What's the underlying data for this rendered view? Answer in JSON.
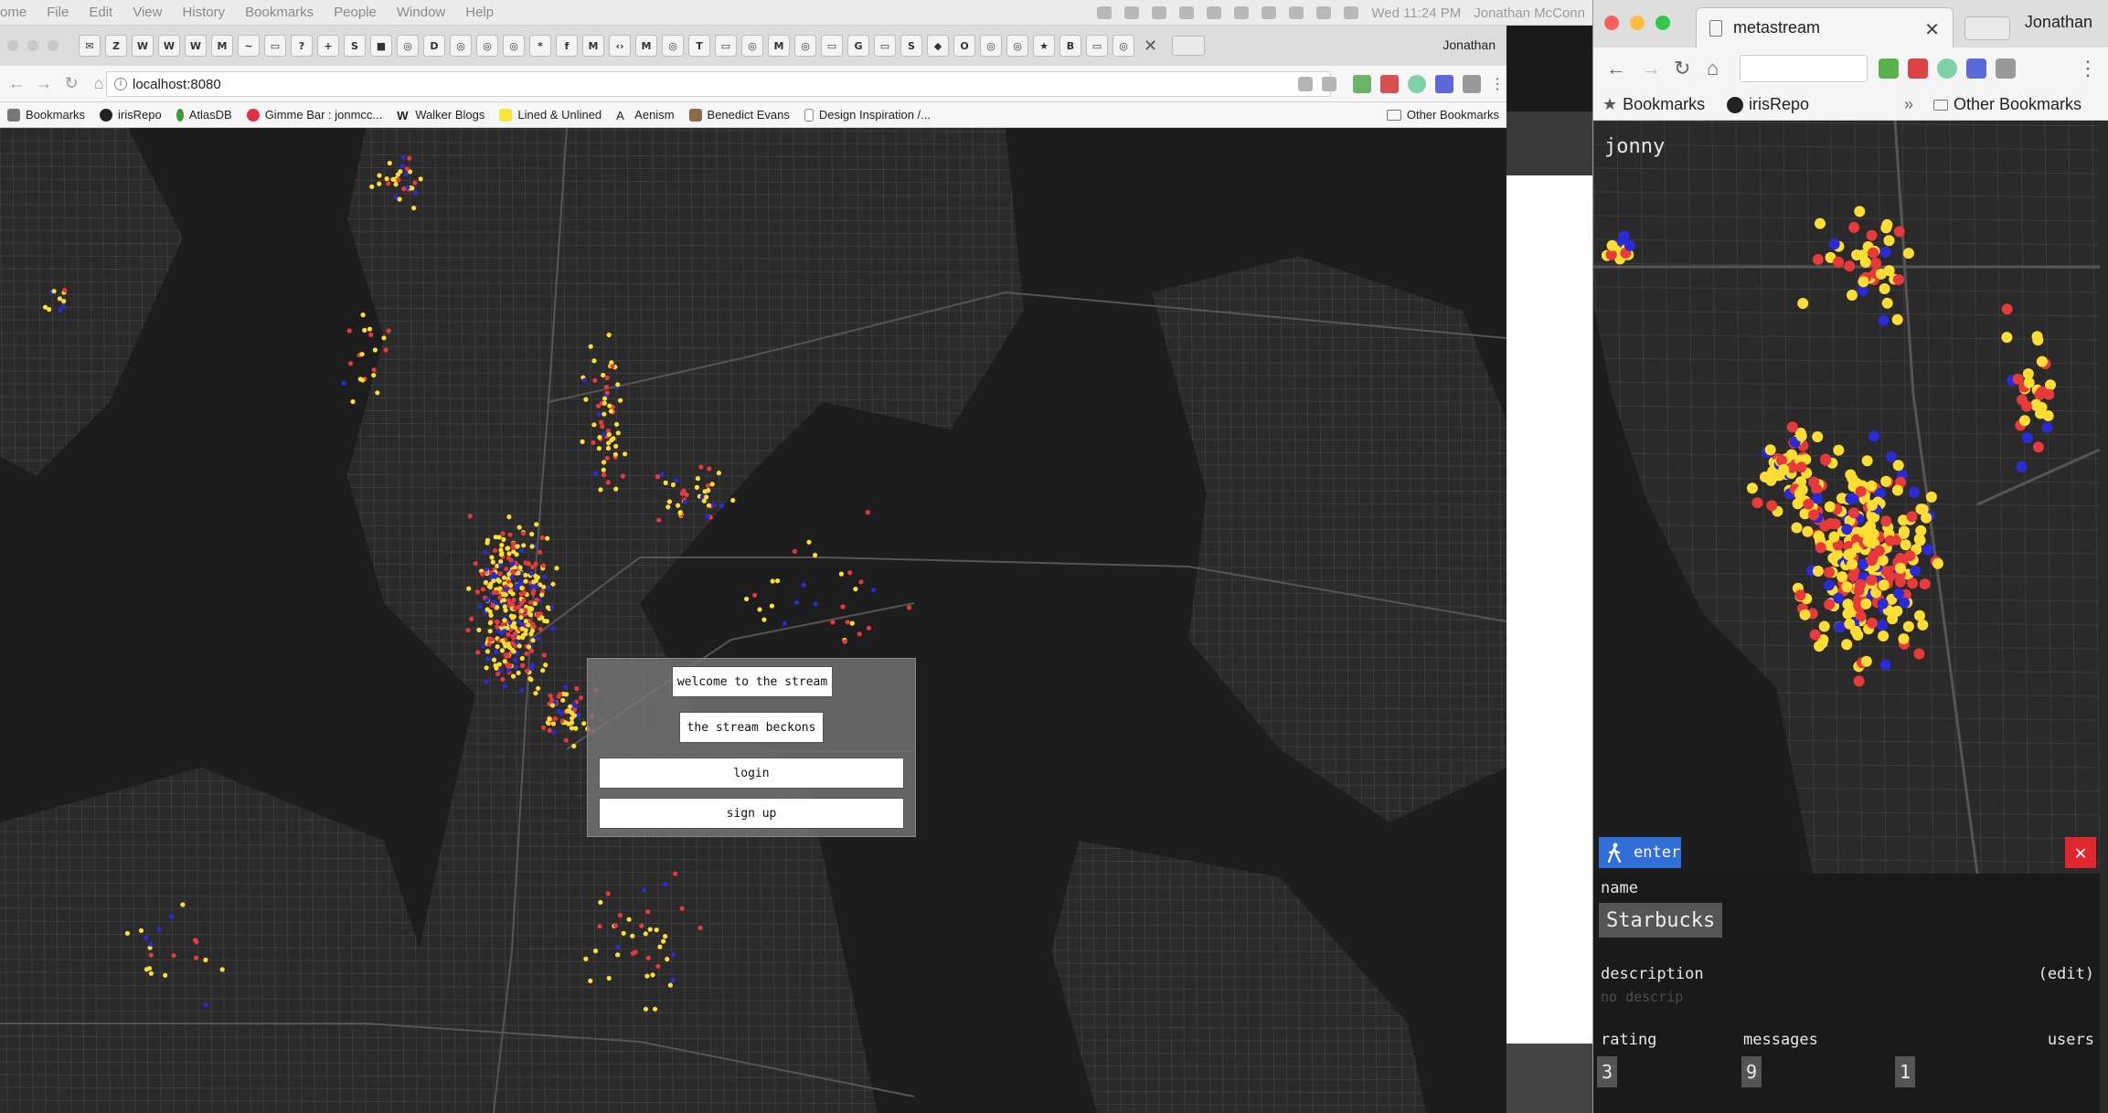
{
  "menubar": {
    "app": "ome",
    "items": [
      "File",
      "Edit",
      "View",
      "History",
      "Bookmarks",
      "People",
      "Window",
      "Help"
    ],
    "clock": "Wed 11:24 PM",
    "user": "Jonathan McConn"
  },
  "left_window": {
    "profile": "Jonathan",
    "url": "localhost:8080",
    "pinned_tabs": [
      "✉",
      "Z",
      "W",
      "W",
      "W",
      "M",
      "~",
      "▭",
      "?",
      "+",
      "S",
      "■",
      "◎",
      "D",
      "◎",
      "◎",
      "◎",
      "*",
      "f",
      "M",
      "‹›",
      "M",
      "◎",
      "T",
      "▭",
      "◎",
      "M",
      "◎",
      "▭",
      "G",
      "▭",
      "S",
      "◆",
      "O",
      "◎",
      "◎",
      "★",
      "B",
      "▭",
      "◎"
    ],
    "bookmarks": [
      {
        "label": "Bookmarks",
        "icon": "star-icon"
      },
      {
        "label": "irisRepo",
        "icon": "github-icon"
      },
      {
        "label": "AtlasDB",
        "icon": "leaf-icon"
      },
      {
        "label": "Gimme Bar : jonmcc...",
        "icon": "gimme-icon"
      },
      {
        "label": "Walker Blogs",
        "icon": "w-icon"
      },
      {
        "label": "Lined & Unlined",
        "icon": "square-icon"
      },
      {
        "label": "Aenism",
        "icon": "a-icon"
      },
      {
        "label": "Benedict Evans",
        "icon": "image-icon"
      },
      {
        "label": "Design Inspiration /...",
        "icon": "page-icon"
      }
    ],
    "other_bookmarks": "Other Bookmarks",
    "modal": {
      "welcome": "welcome to the stream",
      "beckons": "the stream beckons",
      "login": "login",
      "signup": "sign up"
    }
  },
  "right_window": {
    "tab_title": "metastream",
    "profile": "Jonathan",
    "bookmarks": [
      {
        "label": "Bookmarks",
        "icon": "star-icon"
      },
      {
        "label": "irisRepo",
        "icon": "github-icon"
      }
    ],
    "other_bookmarks": "Other Bookmarks",
    "username": "jonny",
    "panel": {
      "enter_label": "enter",
      "name_label": "name",
      "name_value": "Starbucks",
      "description_label": "description",
      "edit_label": "(edit)",
      "description_value": "no descrip",
      "rating_label": "rating",
      "rating_value": "3",
      "messages_label": "messages",
      "messages_value": "9",
      "users_label": "users",
      "users_value": "1"
    }
  },
  "colors": {
    "dot_yellow": "#ffdd33",
    "dot_red": "#e83a3a",
    "dot_blue": "#2a2ad6",
    "enter_blue": "#2f6fd6",
    "close_red": "#e0262f"
  }
}
